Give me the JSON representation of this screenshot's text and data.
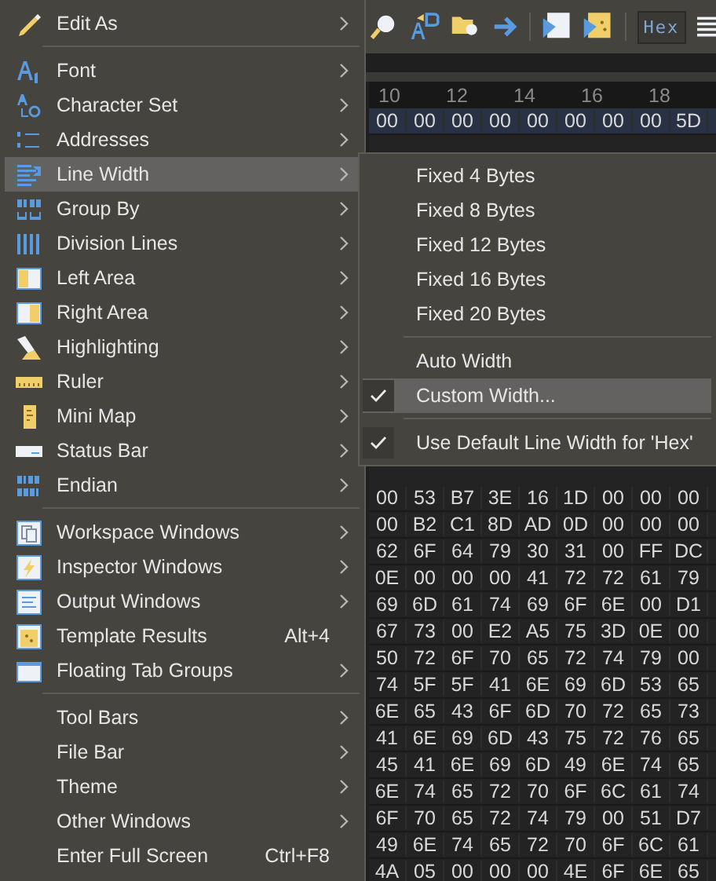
{
  "toolbar": {
    "mode_button": "Hex"
  },
  "hex_view": {
    "ruler": [
      "10",
      "12",
      "14",
      "16",
      "18"
    ],
    "rows": [
      {
        "bytes": [
          "00",
          "00",
          "00",
          "00",
          "00",
          "00",
          "00",
          "00",
          "5D"
        ],
        "selected": true
      },
      {
        "bytes": [
          "00",
          "53",
          "B7",
          "3E",
          "16",
          "1D",
          "00",
          "00",
          "00"
        ],
        "selected": false
      },
      {
        "bytes": [
          "00",
          "B2",
          "C1",
          "8D",
          "AD",
          "0D",
          "00",
          "00",
          "00"
        ],
        "selected": false
      },
      {
        "bytes": [
          "62",
          "6F",
          "64",
          "79",
          "30",
          "31",
          "00",
          "FF",
          "DC"
        ],
        "selected": false
      },
      {
        "bytes": [
          "0E",
          "00",
          "00",
          "00",
          "41",
          "72",
          "72",
          "61",
          "79"
        ],
        "selected": false
      },
      {
        "bytes": [
          "69",
          "6D",
          "61",
          "74",
          "69",
          "6F",
          "6E",
          "00",
          "D1"
        ],
        "selected": false
      },
      {
        "bytes": [
          "67",
          "73",
          "00",
          "E2",
          "A5",
          "75",
          "3D",
          "0E",
          "00"
        ],
        "selected": false
      },
      {
        "bytes": [
          "50",
          "72",
          "6F",
          "70",
          "65",
          "72",
          "74",
          "79",
          "00"
        ],
        "selected": false
      },
      {
        "bytes": [
          "74",
          "5F",
          "5F",
          "41",
          "6E",
          "69",
          "6D",
          "53",
          "65"
        ],
        "selected": false
      },
      {
        "bytes": [
          "6E",
          "65",
          "43",
          "6F",
          "6D",
          "70",
          "72",
          "65",
          "73"
        ],
        "selected": false
      },
      {
        "bytes": [
          "41",
          "6E",
          "69",
          "6D",
          "43",
          "75",
          "72",
          "76",
          "65"
        ],
        "selected": false
      },
      {
        "bytes": [
          "45",
          "41",
          "6E",
          "69",
          "6D",
          "49",
          "6E",
          "74",
          "65"
        ],
        "selected": false
      },
      {
        "bytes": [
          "6E",
          "74",
          "65",
          "72",
          "70",
          "6F",
          "6C",
          "61",
          "74"
        ],
        "selected": false
      },
      {
        "bytes": [
          "6F",
          "70",
          "65",
          "72",
          "74",
          "79",
          "00",
          "51",
          "D7"
        ],
        "selected": false
      },
      {
        "bytes": [
          "49",
          "6E",
          "74",
          "65",
          "72",
          "70",
          "6F",
          "6C",
          "61"
        ],
        "selected": false
      },
      {
        "bytes": [
          "4A",
          "05",
          "00",
          "00",
          "00",
          "4E",
          "6F",
          "6E",
          "65"
        ],
        "selected": false
      }
    ]
  },
  "menu": {
    "items": [
      {
        "kind": "item",
        "label": "Edit As",
        "submenu": true,
        "selected": false
      },
      {
        "kind": "separator"
      },
      {
        "kind": "item",
        "label": "Font",
        "submenu": true,
        "selected": false
      },
      {
        "kind": "item",
        "label": "Character Set",
        "submenu": true,
        "selected": false
      },
      {
        "kind": "item",
        "label": "Addresses",
        "submenu": true,
        "selected": false
      },
      {
        "kind": "item",
        "label": "Line Width",
        "submenu": true,
        "selected": true
      },
      {
        "kind": "item",
        "label": "Group By",
        "submenu": true,
        "selected": false
      },
      {
        "kind": "item",
        "label": "Division Lines",
        "submenu": true,
        "selected": false
      },
      {
        "kind": "item",
        "label": "Left Area",
        "submenu": true,
        "selected": false
      },
      {
        "kind": "item",
        "label": "Right Area",
        "submenu": true,
        "selected": false
      },
      {
        "kind": "item",
        "label": "Highlighting",
        "submenu": true,
        "selected": false
      },
      {
        "kind": "item",
        "label": "Ruler",
        "submenu": true,
        "selected": false
      },
      {
        "kind": "item",
        "label": "Mini Map",
        "submenu": true,
        "selected": false
      },
      {
        "kind": "item",
        "label": "Status Bar",
        "submenu": true,
        "selected": false
      },
      {
        "kind": "item",
        "label": "Endian",
        "submenu": true,
        "selected": false
      },
      {
        "kind": "separator"
      },
      {
        "kind": "item",
        "label": "Workspace Windows",
        "submenu": true,
        "selected": false
      },
      {
        "kind": "item",
        "label": "Inspector Windows",
        "submenu": true,
        "selected": false
      },
      {
        "kind": "item",
        "label": "Output Windows",
        "submenu": true,
        "selected": false
      },
      {
        "kind": "item",
        "label": "Template Results",
        "shortcut": "Alt+4",
        "submenu": false,
        "selected": false
      },
      {
        "kind": "item",
        "label": "Floating Tab Groups",
        "submenu": true,
        "selected": false
      },
      {
        "kind": "separator"
      },
      {
        "kind": "item",
        "label": "Tool Bars",
        "submenu": true,
        "selected": false
      },
      {
        "kind": "item",
        "label": "File Bar",
        "submenu": true,
        "selected": false
      },
      {
        "kind": "item",
        "label": "Theme",
        "submenu": true,
        "selected": false
      },
      {
        "kind": "item",
        "label": "Other Windows",
        "submenu": true,
        "selected": false
      },
      {
        "kind": "item",
        "label": "Enter Full Screen",
        "shortcut": "Ctrl+F8",
        "submenu": false,
        "selected": false
      }
    ]
  },
  "submenu": {
    "items": [
      {
        "kind": "item",
        "label": "Fixed 4 Bytes",
        "checked": false,
        "selected": false
      },
      {
        "kind": "item",
        "label": "Fixed 8 Bytes",
        "checked": false,
        "selected": false
      },
      {
        "kind": "item",
        "label": "Fixed 12 Bytes",
        "checked": false,
        "selected": false
      },
      {
        "kind": "item",
        "label": "Fixed 16 Bytes",
        "checked": false,
        "selected": false
      },
      {
        "kind": "item",
        "label": "Fixed 20 Bytes",
        "checked": false,
        "selected": false
      },
      {
        "kind": "separator"
      },
      {
        "kind": "item",
        "label": "Auto Width",
        "checked": false,
        "selected": false
      },
      {
        "kind": "item",
        "label": "Custom Width...",
        "checked": true,
        "selected": true
      },
      {
        "kind": "separator"
      },
      {
        "kind": "item",
        "label": "Use Default Line Width for 'Hex'",
        "checked": true,
        "selected": false
      }
    ]
  }
}
